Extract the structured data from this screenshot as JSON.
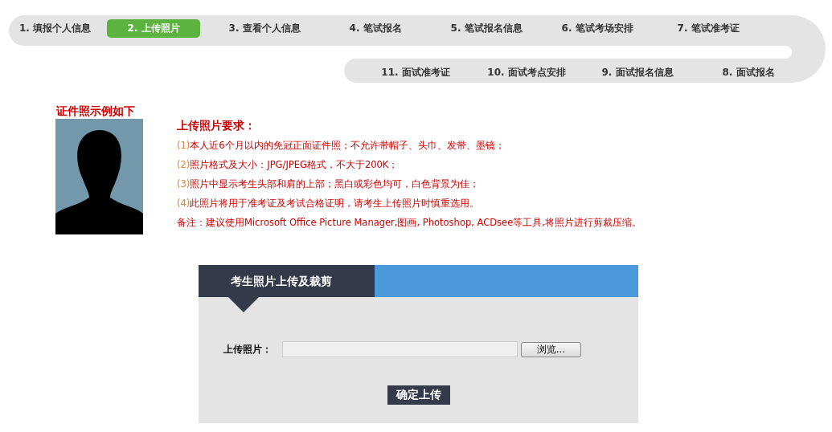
{
  "steps_row_1": [
    {
      "label": "1. 填报个人信息",
      "selected": false
    },
    {
      "label": "2. 上传照片",
      "selected": true
    },
    {
      "label": "3. 查看个人信息",
      "selected": false
    },
    {
      "label": "4. 笔试报名",
      "selected": false
    },
    {
      "label": "5. 笔试报名信息",
      "selected": false
    },
    {
      "label": "6. 笔试考场安排",
      "selected": false
    },
    {
      "label": "7. 笔试准考证",
      "selected": false
    }
  ],
  "steps_row_2": [
    {
      "label": "11. 面试准考证",
      "selected": false
    },
    {
      "label": "10. 面试考点安排",
      "selected": false
    },
    {
      "label": "9. 面试报名信息",
      "selected": false
    },
    {
      "label": "8. 面试报名",
      "selected": false
    }
  ],
  "sample": {
    "title": "证件照示例如下",
    "kind": "picture"
  },
  "requirements": {
    "title": "上传照片要求：",
    "items": [
      {
        "number": "(1)",
        "text": "本人近6个月以内的免冠正面证件照；不允许带帽子、头巾、发带、墨镜；"
      },
      {
        "number": "(2)",
        "text": "照片格式及大小：JPG/JPEG格式，不大于200K；"
      },
      {
        "number": "(3)",
        "text": "照片中显示考生头部和肩的上部；黑白或彩色均可，白色背景为佳；"
      },
      {
        "number": "(4)",
        "text": "此照片将用于准考证及考试合格证明，请考生上传照片时慎重选用。"
      }
    ],
    "note": "备注：建议使用Microsoft Office Picture Manager,图画, Photoshop, ACDsee等工具,将照片进行剪裁压缩。"
  },
  "upload": {
    "title": "考生照片上传及裁剪",
    "field_label": "上传照片：",
    "browse": "浏览...",
    "submit": "确定上传"
  }
}
